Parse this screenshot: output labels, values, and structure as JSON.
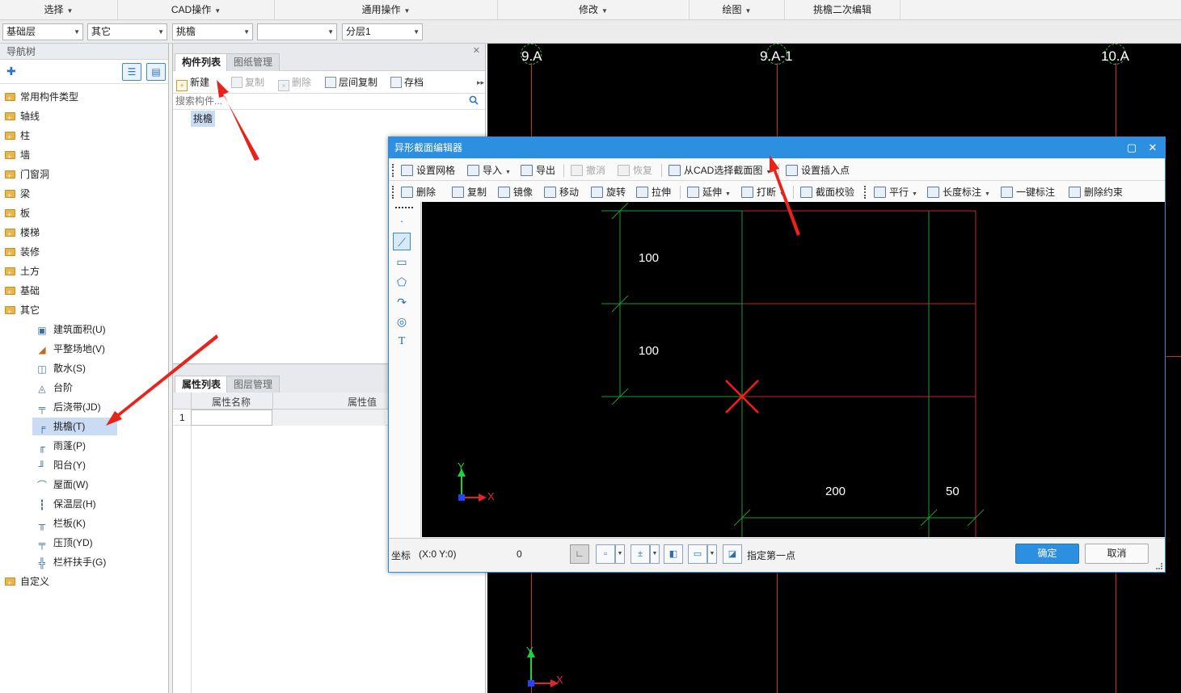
{
  "menu": {
    "items": [
      "选择",
      "CAD操作",
      "通用操作",
      "修改",
      "绘图",
      "挑檐二次编辑"
    ]
  },
  "combos": {
    "floor": "基础层",
    "category": "其它",
    "type": "挑檐",
    "blank": "",
    "sublayer": "分层1"
  },
  "nav": {
    "title": "导航树",
    "folders": [
      "常用构件类型",
      "轴线",
      "柱",
      "墙",
      "门窗洞",
      "梁",
      "板",
      "楼梯",
      "装修",
      "土方",
      "基础",
      "其它"
    ],
    "children": [
      {
        "label": "建筑面积(U)",
        "icon": "area-icon"
      },
      {
        "label": "平整场地(V)",
        "icon": "site-level-icon"
      },
      {
        "label": "散水(S)",
        "icon": "apron-icon"
      },
      {
        "label": "台阶",
        "icon": "steps-icon"
      },
      {
        "label": "后浇带(JD)",
        "icon": "post-cast-strip-icon"
      },
      {
        "label": "挑檐(T)",
        "icon": "eave-icon"
      },
      {
        "label": "雨蓬(P)",
        "icon": "canopy-icon"
      },
      {
        "label": "阳台(Y)",
        "icon": "balcony-icon"
      },
      {
        "label": "屋面(W)",
        "icon": "roof-icon"
      },
      {
        "label": "保温层(H)",
        "icon": "insulation-icon"
      },
      {
        "label": "栏板(K)",
        "icon": "parapet-icon"
      },
      {
        "label": "压顶(YD)",
        "icon": "coping-icon"
      },
      {
        "label": "栏杆扶手(G)",
        "icon": "railing-icon"
      }
    ],
    "last_folder": "自定义"
  },
  "components": {
    "tab_active": "构件列表",
    "tab_inactive": "图纸管理",
    "toolbar": {
      "new": "新建",
      "copy": "复制",
      "delete": "删除",
      "floor_copy": "层间复制",
      "save": "存档"
    },
    "search_placeholder": "搜索构件...",
    "item": "挑檐"
  },
  "properties": {
    "tab_active": "属性列表",
    "tab_inactive": "图层管理",
    "col_name": "属性名称",
    "col_value": "属性值",
    "row1_index": "1"
  },
  "cad": {
    "axes": [
      "9.A",
      "9.A-1",
      "10.A"
    ],
    "ucs_y": "Y",
    "ucs_x": "X"
  },
  "dialog": {
    "title": "异形截面编辑器",
    "toolbar1": {
      "grid": "设置网格",
      "import": "导入",
      "export": "导出",
      "undo": "撤消",
      "redo": "恢复",
      "from_cad": "从CAD选择截面图",
      "insert_point": "设置插入点"
    },
    "toolbar2": {
      "delete": "删除",
      "copy": "复制",
      "mirror": "镜像",
      "move": "移动",
      "rotate": "旋转",
      "stretch": "拉伸",
      "extend": "延伸",
      "break": "打断",
      "check": "截面校验",
      "parallel": "平行",
      "length_dim": "长度标注",
      "auto_dim": "一键标注",
      "remove_constraint": "删除约束"
    },
    "dims": [
      "100",
      "100",
      "200",
      "50"
    ],
    "ucs_y": "Y",
    "ucs_x": "X",
    "status": {
      "coord_label": "坐标",
      "coord_value": "(X:0 Y:0)",
      "angle": "0",
      "prompt": "指定第一点"
    },
    "ok": "确定",
    "cancel": "取消"
  },
  "colors": {
    "accent": "#2d8fe0",
    "cad_bg": "#000000",
    "axis_line": "#d8262a",
    "grid_green": "#1f9a2e",
    "arrow_red": "#e8231c"
  }
}
